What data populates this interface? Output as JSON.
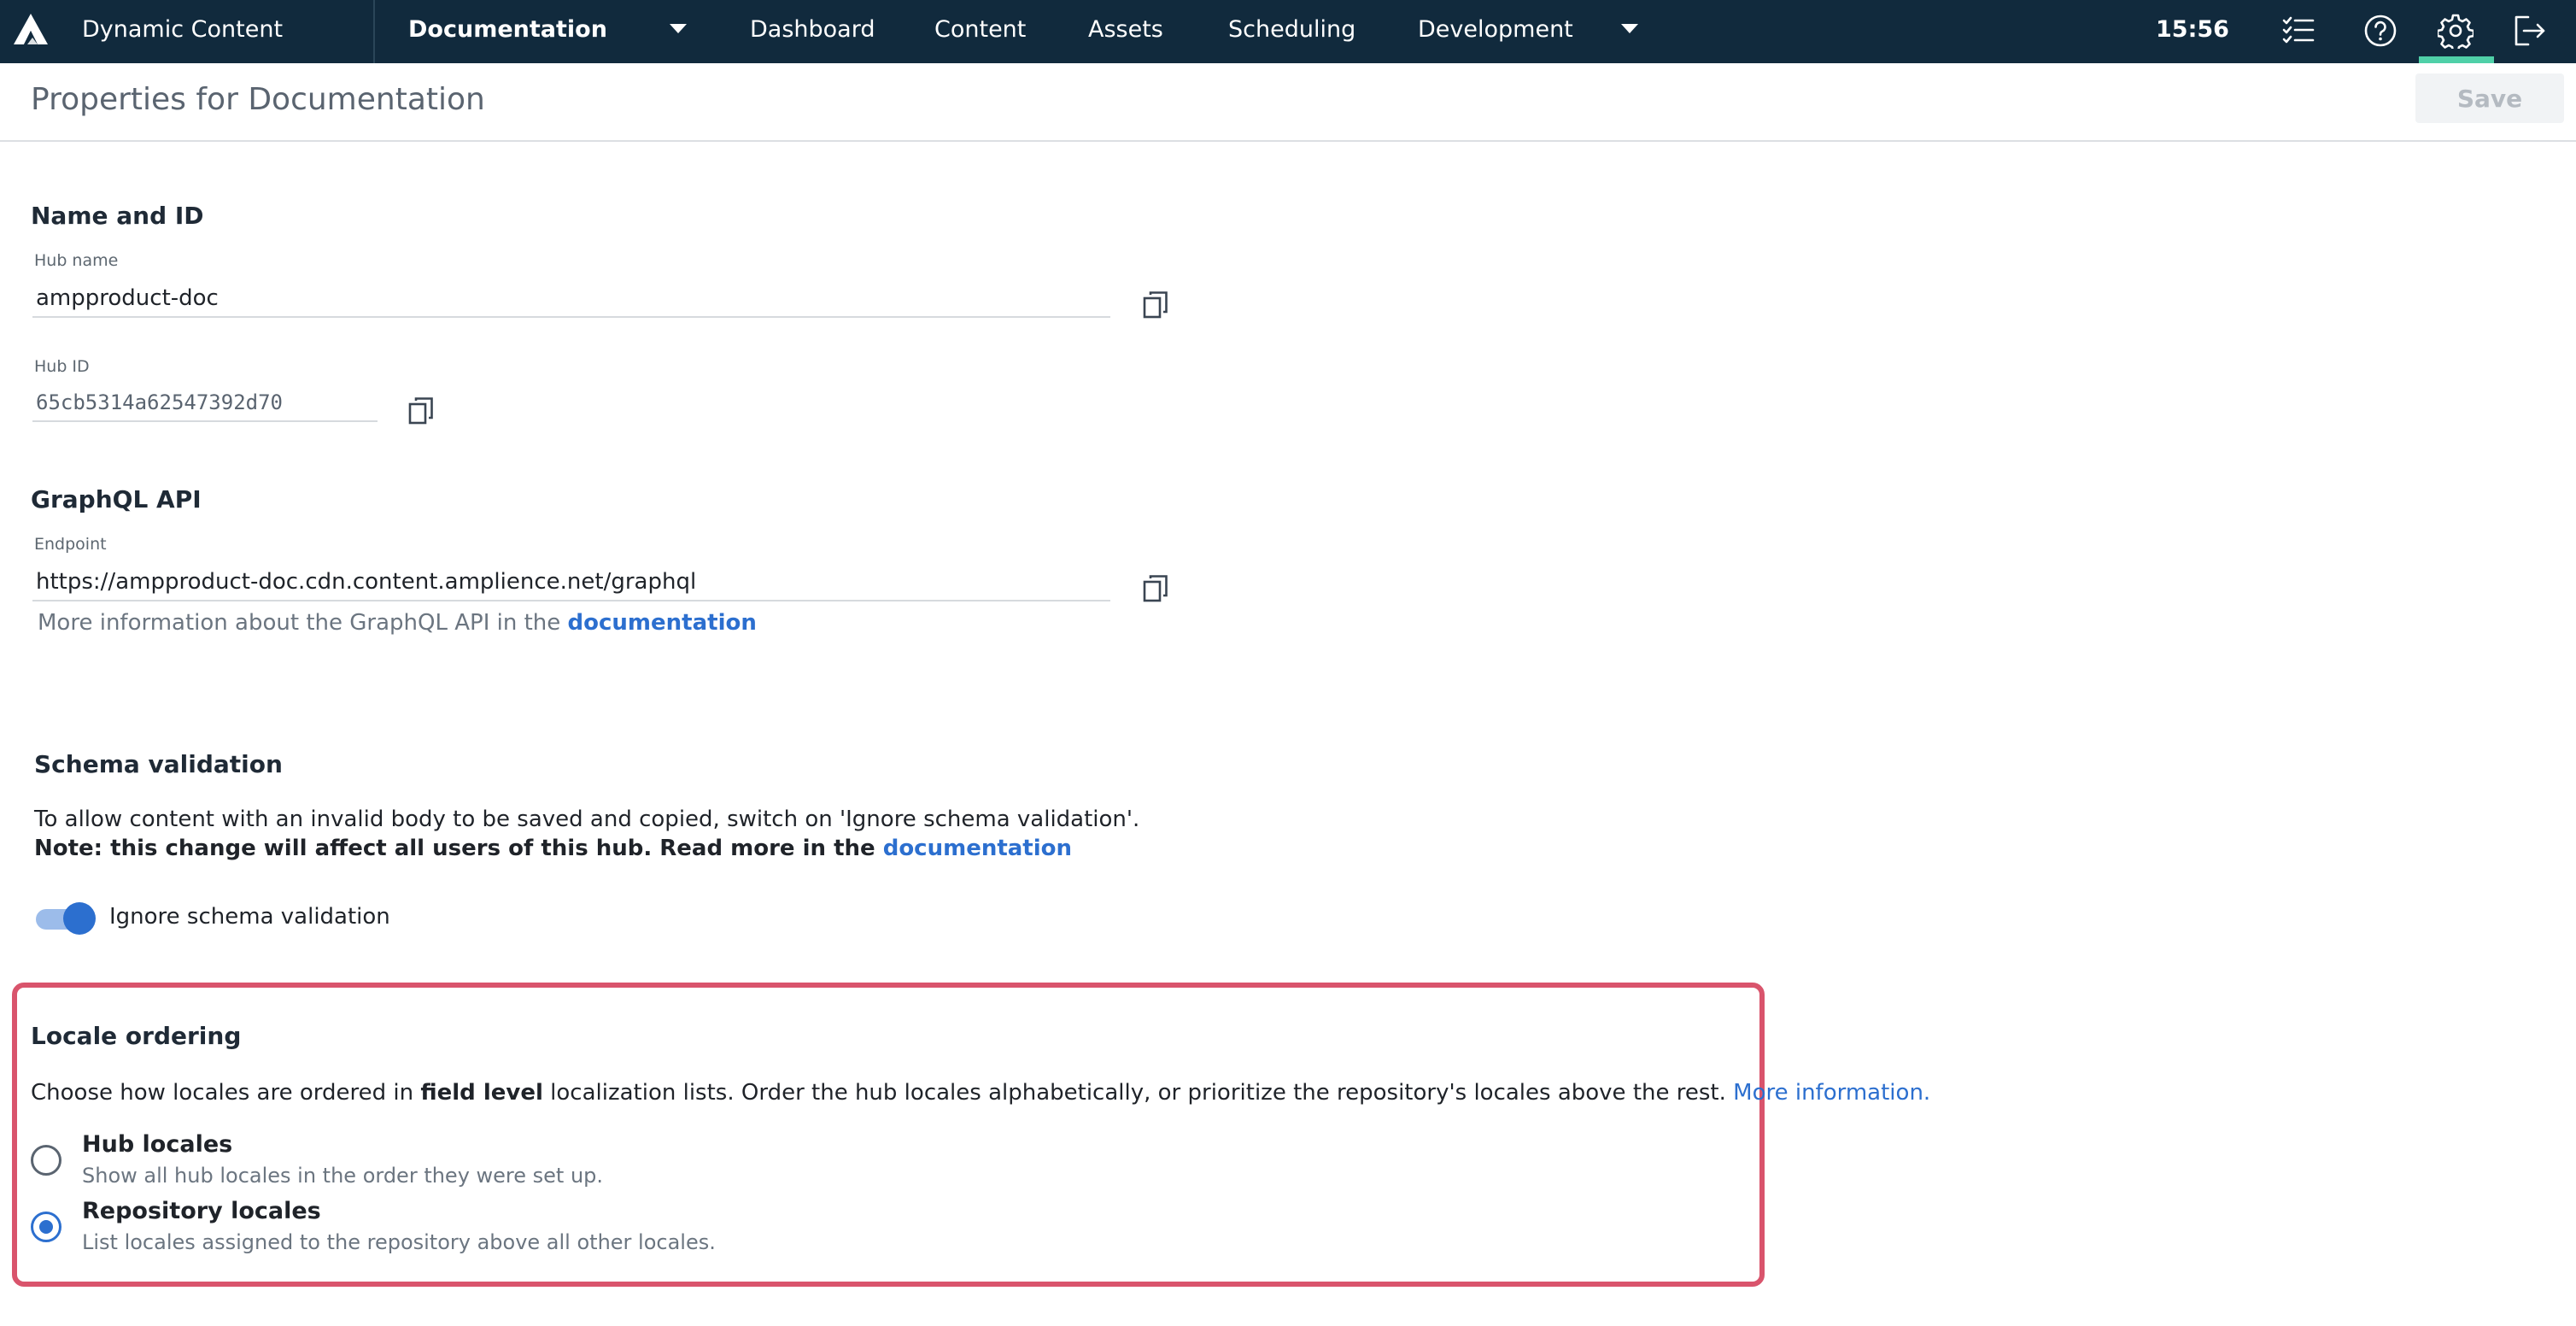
{
  "header": {
    "app_name": "Dynamic Content",
    "hub_selector": "Documentation",
    "nav_items": [
      "Dashboard",
      "Content",
      "Assets",
      "Scheduling",
      "Development"
    ],
    "time": "15:56",
    "icons": {
      "logo": "amplience-logo-icon",
      "tasks": "task-list-icon",
      "help": "help-icon",
      "settings": "gear-icon",
      "logout": "logout-icon"
    }
  },
  "page": {
    "title": "Properties for Documentation",
    "save_label": "Save"
  },
  "name_and_id": {
    "title": "Name and ID",
    "hub_name_label": "Hub name",
    "hub_name_value": "ampproduct-doc",
    "hub_id_label": "Hub ID",
    "hub_id_value": "65cb5314a62547392d70"
  },
  "graphql": {
    "title": "GraphQL API",
    "endpoint_label": "Endpoint",
    "endpoint_value": "https://ampproduct-doc.cdn.content.amplience.net/graphql",
    "info_text": "More information about the GraphQL API in the ",
    "info_link": "documentation"
  },
  "schema_validation": {
    "title": "Schema validation",
    "description": "To allow content with an invalid body to be saved and copied, switch on 'Ignore schema validation'.",
    "note": "Note: this change will affect all users of this hub. Read more in the ",
    "note_link": "documentation",
    "toggle_label": "Ignore schema validation",
    "toggle_on": true
  },
  "locale_ordering": {
    "title": "Locale ordering",
    "desc_prefix": "Choose how locales are ordered in ",
    "desc_bold": "field level",
    "desc_suffix": " localization lists. Order the hub locales alphabetically, or prioritize the repository's locales above the rest. ",
    "desc_link": "More information.",
    "options": [
      {
        "label": "Hub locales",
        "description": "Show all hub locales in the order they were set up.",
        "selected": false
      },
      {
        "label": "Repository locales",
        "description": "List locales assigned to the repository above all other locales.",
        "selected": true
      }
    ]
  },
  "colors": {
    "topbar": "#112a3d",
    "accent": "#2c6fcf",
    "settings_indicator": "#4fd0a8",
    "highlight_border": "#d9546c"
  }
}
